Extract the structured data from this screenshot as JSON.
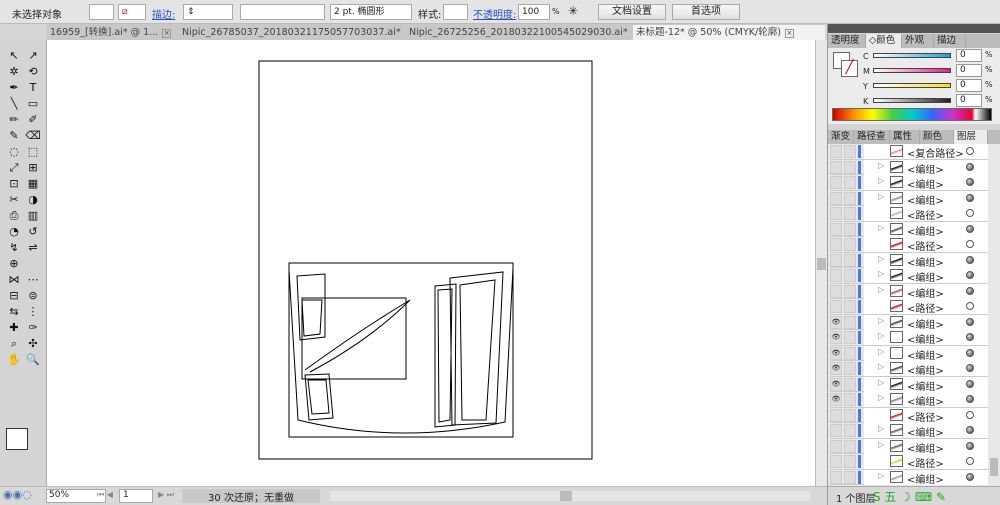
{
  "control_bar": {
    "selection": "未选择对象",
    "stroke_label": "描边:",
    "brush": "2 pt. 椭圆形",
    "style_label": "样式:",
    "opacity_label": "不透明度:",
    "opacity_value": "100",
    "percent": "%",
    "doc_setup": "文档设置",
    "preferences": "首选项"
  },
  "tabs": [
    {
      "label": "16959_[转换].ai* @ 1..."
    },
    {
      "label": "Nipic_26785037_20180321175057703037.ai*"
    },
    {
      "label": "Nipic_26725256_20180322100545029030.ai*"
    },
    {
      "label": "未标题-12* @ 50% (CMYK/轮廓)",
      "active": true
    }
  ],
  "color_panel": {
    "tabs": [
      "透明度",
      "◇颜色",
      "外观",
      "描边"
    ],
    "channels": [
      {
        "name": "C",
        "value": "0",
        "color": "#1aa0e0"
      },
      {
        "name": "M",
        "value": "0",
        "color": "#e0208a"
      },
      {
        "name": "Y",
        "value": "0",
        "color": "#f0e020"
      },
      {
        "name": "K",
        "value": "0",
        "color": "#222222"
      }
    ],
    "percent": "%"
  },
  "layers_panel": {
    "tabs": [
      "渐变",
      "路径查",
      "属性",
      "颜色参",
      "图层"
    ],
    "rows": [
      {
        "name": "<复合路径>",
        "group": false,
        "eye": false,
        "thumb": "#e88"
      },
      {
        "name": "<编组>",
        "group": true,
        "eye": false,
        "thumb": "#000"
      },
      {
        "name": "<编组>",
        "group": true,
        "eye": false,
        "thumb": "#000"
      },
      {
        "name": "<编组>",
        "group": true,
        "eye": false,
        "thumb": "#888"
      },
      {
        "name": "<路径>",
        "group": false,
        "eye": false,
        "thumb": "#ca8"
      },
      {
        "name": "<编组>",
        "group": true,
        "eye": false,
        "thumb": "#444"
      },
      {
        "name": "<路径>",
        "group": false,
        "eye": false,
        "thumb": "#c00"
      },
      {
        "name": "<编组>",
        "group": true,
        "eye": false,
        "thumb": "#000"
      },
      {
        "name": "<编组>",
        "group": true,
        "eye": false,
        "thumb": "#000"
      },
      {
        "name": "<编组>",
        "group": true,
        "eye": false,
        "thumb": "#a44"
      },
      {
        "name": "<路径>",
        "group": false,
        "eye": false,
        "thumb": "#c00"
      },
      {
        "name": "<编组>",
        "group": true,
        "eye": true,
        "thumb": "#333"
      },
      {
        "name": "<编组>",
        "group": true,
        "eye": true,
        "thumb": "#fff"
      },
      {
        "name": "<编组>",
        "group": true,
        "eye": true,
        "thumb": "#fff"
      },
      {
        "name": "<编组>",
        "group": true,
        "eye": true,
        "thumb": "#333"
      },
      {
        "name": "<编组>",
        "group": true,
        "eye": true,
        "thumb": "#000"
      },
      {
        "name": "<编组>",
        "group": true,
        "eye": true,
        "thumb": "#777"
      },
      {
        "name": "<路径>",
        "group": false,
        "eye": false,
        "thumb": "#d00"
      },
      {
        "name": "<编组>",
        "group": true,
        "eye": false,
        "thumb": "#555"
      },
      {
        "name": "<编组>",
        "group": true,
        "eye": false,
        "thumb": "#555"
      },
      {
        "name": "<路径>",
        "group": false,
        "eye": false,
        "thumb": "#dc3"
      },
      {
        "name": "<编组>",
        "group": true,
        "eye": false,
        "thumb": "#999"
      }
    ],
    "footer": "1 个图层"
  },
  "status": {
    "zoom": "50%",
    "page": "1",
    "info": "30 次还原；无重做"
  }
}
